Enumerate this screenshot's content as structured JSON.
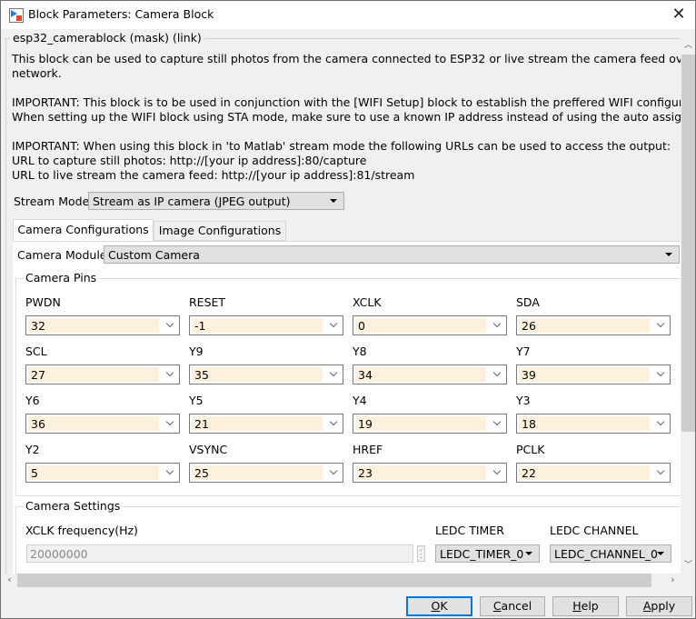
{
  "window": {
    "title": "Block Parameters: Camera Block",
    "close_icon": "close-icon"
  },
  "mask": {
    "legend": "esp32_camerablock (mask) (link)",
    "description": "This block can be used to capture still photos from the camera connected to ESP32 or live stream the camera feed over a TCP/IP\nnetwork.\n\nIMPORTANT: This block is to be used in conjunction with the [WIFI Setup] block to establish the preffered WIFI configuration.\nWhen setting up the WIFI block using STA mode, make sure to use a known IP address instead of using the auto assign feature\n\nIMPORTANT: When using this block in 'to Matlab' stream mode the following URLs can be used to access the output:\nURL to capture still photos: http://[your ip address]:80/capture\nURL to live stream the camera feed: http://[your ip address]:81/stream"
  },
  "stream_mode": {
    "label": "Stream Mode",
    "value": "Stream as IP camera (JPEG output)"
  },
  "tabs": [
    {
      "label": "Camera Configurations",
      "active": true
    },
    {
      "label": "Image Configurations",
      "active": false
    }
  ],
  "camera_module": {
    "label": "Camera Module",
    "value": "Custom Camera"
  },
  "camera_pins": {
    "legend": "Camera Pins",
    "pins": [
      {
        "label": "PWDN",
        "value": "32"
      },
      {
        "label": "RESET",
        "value": "-1"
      },
      {
        "label": "XCLK",
        "value": "0"
      },
      {
        "label": "SDA",
        "value": "26"
      },
      {
        "label": "SCL",
        "value": "27"
      },
      {
        "label": "Y9",
        "value": "35"
      },
      {
        "label": "Y8",
        "value": "34"
      },
      {
        "label": "Y7",
        "value": "39"
      },
      {
        "label": "Y6",
        "value": "36"
      },
      {
        "label": "Y5",
        "value": "21"
      },
      {
        "label": "Y4",
        "value": "19"
      },
      {
        "label": "Y3",
        "value": "18"
      },
      {
        "label": "Y2",
        "value": "5"
      },
      {
        "label": "VSYNC",
        "value": "25"
      },
      {
        "label": "HREF",
        "value": "23"
      },
      {
        "label": "PCLK",
        "value": "22"
      }
    ]
  },
  "camera_settings": {
    "legend": "Camera Settings",
    "xclk_label": "XCLK frequency(Hz)",
    "xclk_value": "20000000",
    "ledc_timer_label": "LEDC TIMER",
    "ledc_timer_value": "LEDC_TIMER_0",
    "ledc_channel_label": "LEDC CHANNEL",
    "ledc_channel_value": "LEDC_CHANNEL_0"
  },
  "buttons": {
    "ok": {
      "mnemonic": "O",
      "rest": "K"
    },
    "cancel": {
      "mnemonic": "C",
      "rest": "ancel"
    },
    "help": {
      "mnemonic": "H",
      "rest": "elp"
    },
    "apply": {
      "mnemonic": "A",
      "rest": "pply"
    }
  }
}
